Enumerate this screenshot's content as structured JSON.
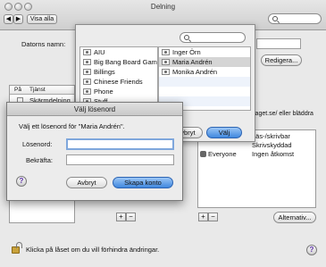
{
  "window": {
    "title": "Delning"
  },
  "toolbar": {
    "show_all_label": "Visa alla"
  },
  "computer_name": {
    "label": "Datorns namn:",
    "edit_label": "Redigera..."
  },
  "services": {
    "col_on": "På",
    "col_service": "Tjänst",
    "items": [
      {
        "label": "Skärmdelning"
      }
    ]
  },
  "background": {
    "address_hint": "laget.se/ eller bläddra",
    "permissions": [
      {
        "name": "",
        "permission": "Läs-/skrivbar"
      },
      {
        "name": "",
        "permission": "Skrivskyddad"
      },
      {
        "name": "Everyone",
        "permission": "Ingen åtkomst"
      }
    ],
    "options_label": "Alternativ..."
  },
  "picker": {
    "groups": [
      {
        "label": "AIU"
      },
      {
        "label": "Big Bang Board Games"
      },
      {
        "label": "Billings"
      },
      {
        "label": "Chinese Friends"
      },
      {
        "label": "Phone"
      },
      {
        "label": "Stuff"
      }
    ],
    "people": [
      {
        "label": "Inger Örn"
      },
      {
        "label": "Maria Andrén"
      },
      {
        "label": "Monika Andrén"
      }
    ],
    "cancel_label": "Avbryt",
    "choose_label": "Välj"
  },
  "dialog": {
    "title": "Välj lösenord",
    "prompt": "Välj ett lösenord för \"Maria Andrén\".",
    "password_label": "Lösenord:",
    "confirm_label": "Bekräfta:",
    "cancel_label": "Avbryt",
    "create_label": "Skapa konto"
  },
  "footer": {
    "lock_text": "Klicka på låset om du vill förhindra ändringar."
  }
}
